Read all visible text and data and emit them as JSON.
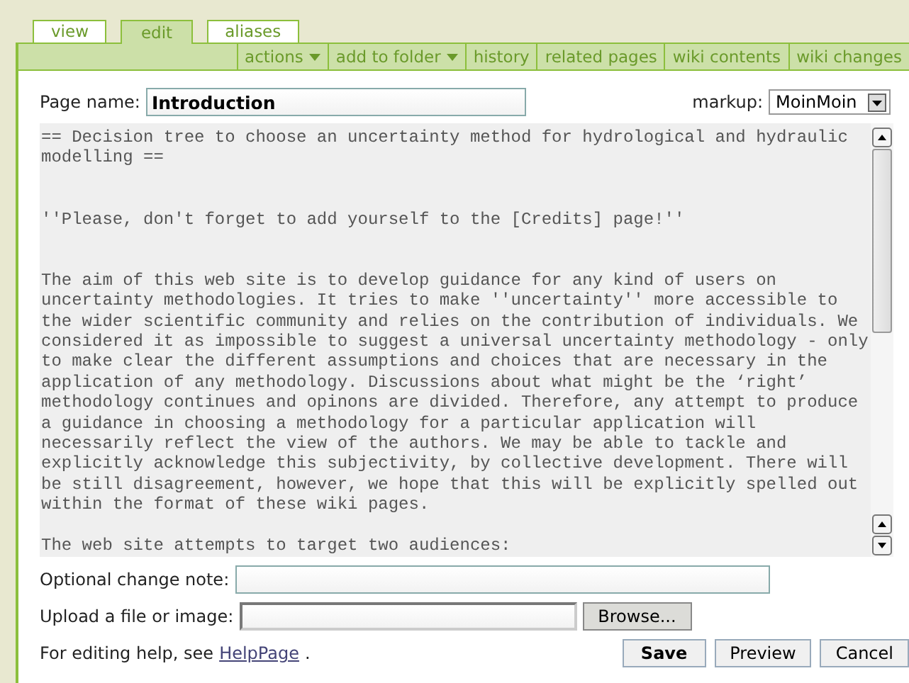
{
  "tabs": [
    {
      "label": "view",
      "selected": false
    },
    {
      "label": "edit",
      "selected": true
    },
    {
      "label": "aliases",
      "selected": false
    }
  ],
  "menu": [
    {
      "label": "actions",
      "dropdown": true
    },
    {
      "label": "add to folder",
      "dropdown": true
    },
    {
      "label": "history",
      "dropdown": false
    },
    {
      "label": "related pages",
      "dropdown": false
    },
    {
      "label": "wiki contents",
      "dropdown": false
    },
    {
      "label": "wiki changes",
      "dropdown": false
    }
  ],
  "page_name": {
    "label": "Page name:",
    "value": "Introduction"
  },
  "markup": {
    "label": "markup:",
    "value": "MoinMoin"
  },
  "editor": {
    "blocks": [
      {
        "lines": [
          "== Decision tree to choose an uncertainty method for hydrological and hydraulic",
          "modelling =="
        ]
      },
      {
        "lines": [
          "''Please, don't forget to add yourself to the [Credits] page!''"
        ]
      },
      {
        "lines": [
          "The aim of this web site is to develop guidance for any kind of users on",
          "uncertainty methodologies. It tries to make ''uncertainty'' more accessible to",
          "the wider scientific community and relies on the contribution of individuals. We",
          "considered it as impossible to suggest a universal uncertainty methodology - only",
          "to make clear the different assumptions and choices that are necessary in the",
          "application of any methodology. Discussions about what might be the ‘right’",
          "methodology continues and opinons are divided. Therefore, any attempt to produce",
          "a guidance in choosing a methodology for a particular application will",
          "necessarily reflect the view of the authors. We may be able to tackle and",
          "explicitly acknowledge this subjectivity, by collective development. There will",
          "be still disagreement, however, we hope that this will be explicitly spelled out",
          "within the format of these wiki pages."
        ]
      },
      {
        "lines": [
          "The web site attempts to target two audiences:"
        ]
      }
    ]
  },
  "change_note": {
    "label": "Optional change note:"
  },
  "upload": {
    "label": "Upload a file or image:",
    "button": "Browse..."
  },
  "help": {
    "text": "For editing help, see",
    "link": "HelpPage",
    "after": "."
  },
  "buttons": [
    {
      "label": "Save",
      "primary": true
    },
    {
      "label": "Preview",
      "primary": false
    },
    {
      "label": "Cancel",
      "primary": false
    }
  ]
}
